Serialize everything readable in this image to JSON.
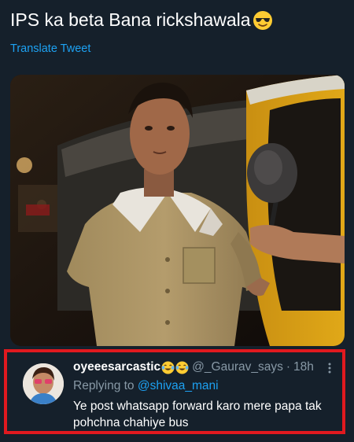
{
  "tweet": {
    "text": "IPS ka beta Bana rickshawala",
    "emoji": "sunglasses-face-emoji",
    "translate_label": "Translate Tweet"
  },
  "reply": {
    "display_name": "oyeeesarcastic",
    "name_emojis": [
      "tears-of-joy-emoji",
      "tears-of-joy-emoji"
    ],
    "handle": "@_Gaurav_says",
    "separator": "·",
    "time": "18h",
    "replying_label": "Replying to",
    "replying_to": "@shivaa_mani",
    "text": "Ye post whatsapp forward karo mere papa tak pohchna chahiye bus"
  },
  "colors": {
    "background": "#15202b",
    "link": "#1da1f2",
    "muted": "#8899a6",
    "highlight_border": "#e0191f"
  }
}
